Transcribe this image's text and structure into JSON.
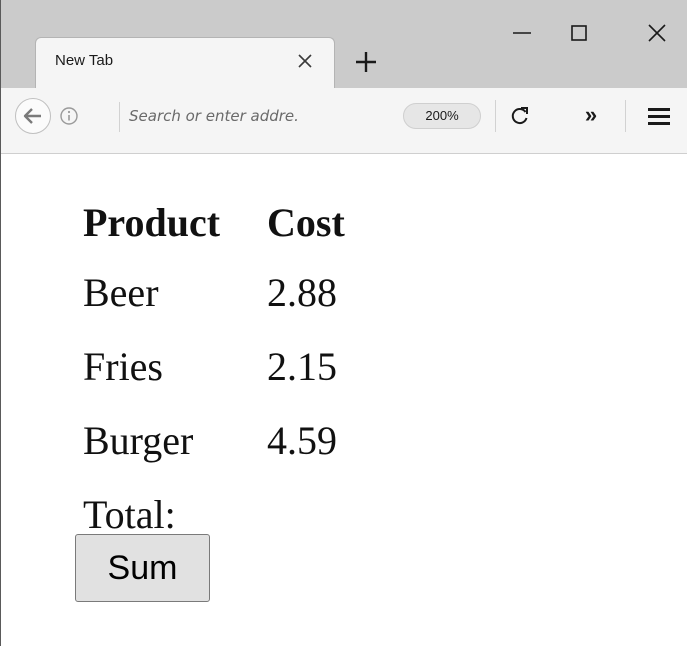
{
  "browser": {
    "tab": {
      "title": "New Tab"
    },
    "address_bar": {
      "placeholder": "Search or enter addre.",
      "value": ""
    },
    "zoom_level": "200%",
    "overflow_label": "»"
  },
  "page": {
    "table": {
      "headers": [
        "Product",
        "Cost"
      ],
      "rows": [
        {
          "product": "Beer",
          "cost": "2.88"
        },
        {
          "product": "Fries",
          "cost": "2.15"
        },
        {
          "product": "Burger",
          "cost": "4.59"
        }
      ],
      "total_label": "Total:",
      "total_value": ""
    },
    "sum_button_label": "Sum"
  },
  "colors": {
    "titlebar": "#cbcbcb",
    "toolbar": "#f5f5f5",
    "button_face": "#e1e1e1"
  }
}
